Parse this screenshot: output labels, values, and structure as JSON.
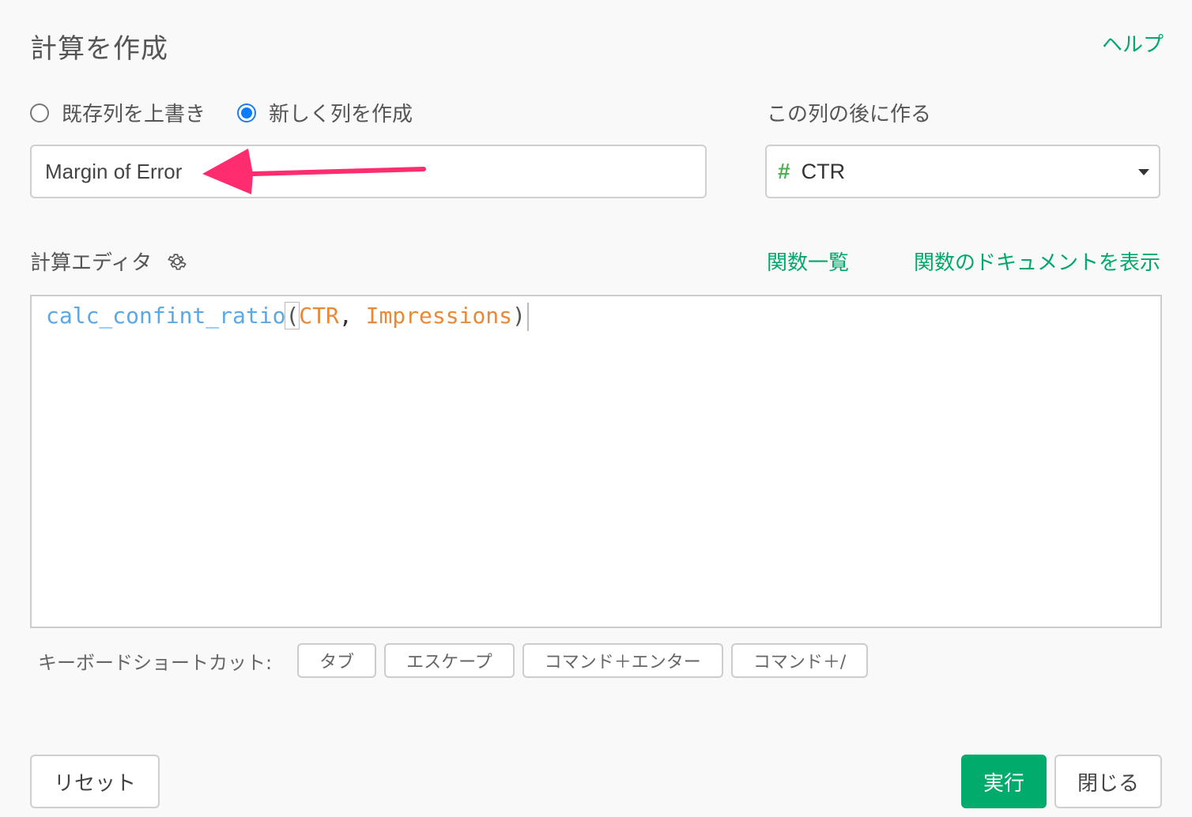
{
  "dialog": {
    "title": "計算を作成",
    "help_link": "ヘルプ"
  },
  "mode": {
    "options": [
      {
        "label": "既存列を上書き",
        "checked": false
      },
      {
        "label": "新しく列を作成",
        "checked": true
      }
    ]
  },
  "column_name": {
    "value": "Margin of Error"
  },
  "insert_after": {
    "label": "この列の後に作る",
    "type_icon": "#",
    "selected": "CTR"
  },
  "editor": {
    "label": "計算エディタ",
    "function_list_link": "関数一覧",
    "function_docs_link": "関数のドキュメントを表示",
    "code": {
      "function": "calc_confint_ratio",
      "open_paren": "(",
      "arg1": "CTR",
      "comma": ", ",
      "arg2": "Impressions",
      "close_paren": ")"
    }
  },
  "shortcuts": {
    "label": "キーボードショートカット:",
    "keys": [
      "タブ",
      "エスケープ",
      "コマンド＋エンター",
      "コマンド＋/"
    ]
  },
  "footer": {
    "reset_label": "リセット",
    "run_label": "実行",
    "close_label": "閉じる"
  },
  "colors": {
    "accent_green": "#00ab6c",
    "radio_blue": "#0a7cff",
    "annotation_arrow": "#ff2d6f",
    "function_token": "#5aa8e6",
    "argument_token": "#e8893a"
  }
}
